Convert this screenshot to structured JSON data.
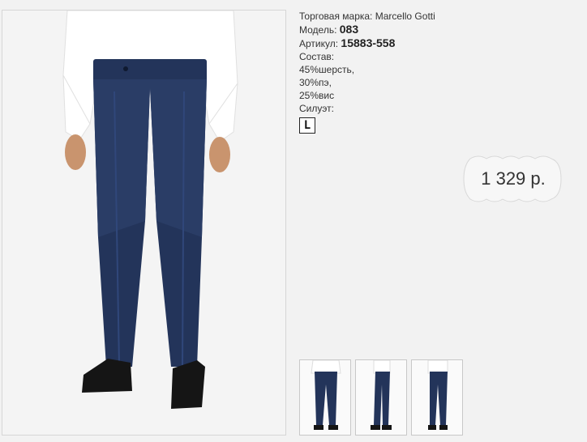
{
  "product": {
    "brand_label": "Торговая марка:",
    "brand_value": "Marcello Gotti",
    "model_label": "Модель:",
    "model_value": "083",
    "article_label": "Артикул:",
    "article_value": "15883-558",
    "composition_label": "Состав:",
    "composition": [
      "45%шерсть,",
      "30%пэ,",
      "25%вис"
    ],
    "silhouette_label": "Силуэт:",
    "silhouette_value": "L",
    "price": "1 329 р."
  },
  "colors": {
    "pants": "#23345a",
    "shirt": "#ffffff",
    "shoes": "#151515"
  }
}
